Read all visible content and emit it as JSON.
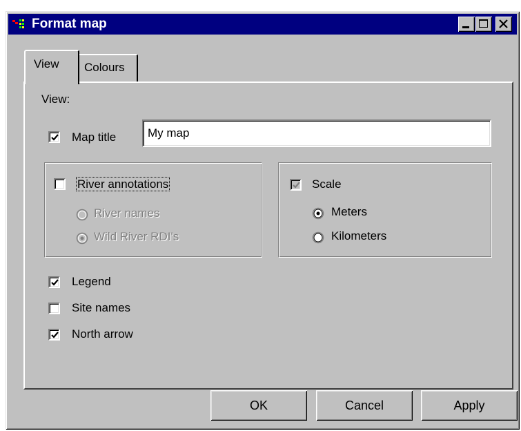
{
  "window": {
    "title": "Format map",
    "icon": "app-map-icon"
  },
  "caption_buttons": {
    "minimize": "minimize-icon",
    "maximize": "maximize-icon",
    "close": "close-icon"
  },
  "tabs": [
    {
      "label": "View",
      "selected": true
    },
    {
      "label": "Colours",
      "selected": false
    }
  ],
  "view": {
    "section_label": "View:",
    "map_title": {
      "label": "Map title",
      "checked": true,
      "value": "My map"
    },
    "river_annotations": {
      "label": "River annotations",
      "checked": false,
      "options": [
        {
          "label": "River names",
          "selected": false,
          "enabled": false
        },
        {
          "label": "Wild River RDI's",
          "selected": true,
          "enabled": false
        }
      ]
    },
    "scale": {
      "label": "Scale",
      "checked": true,
      "enabled": false,
      "options": [
        {
          "label": "Meters",
          "selected": true
        },
        {
          "label": "Kilometers",
          "selected": false
        }
      ]
    },
    "legend": {
      "label": "Legend",
      "checked": true
    },
    "site_names": {
      "label": "Site names",
      "checked": false
    },
    "north_arrow": {
      "label": "North arrow",
      "checked": true
    }
  },
  "buttons": {
    "ok": "OK",
    "cancel": "Cancel",
    "apply": "Apply"
  }
}
